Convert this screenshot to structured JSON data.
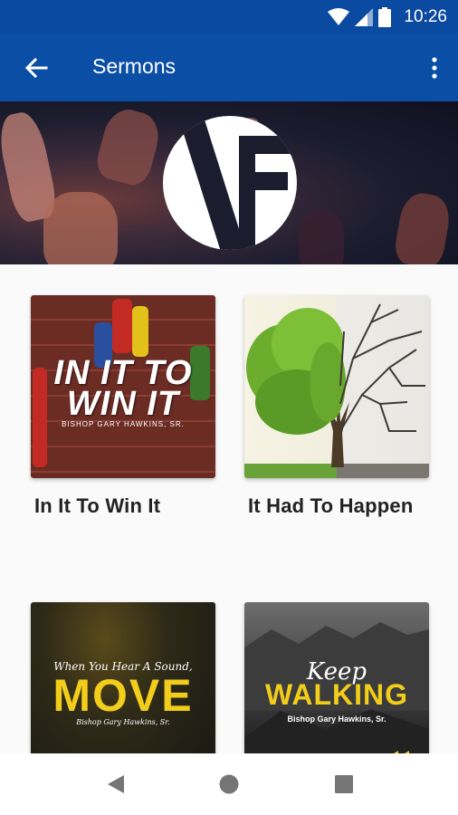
{
  "status_bar": {
    "time": "10:26",
    "icons": [
      "wifi-icon",
      "cell-signal-icon",
      "battery-icon"
    ]
  },
  "app_bar": {
    "title": "Sermons",
    "back_icon": "arrow-left-icon",
    "menu_icon": "more-vert-icon"
  },
  "banner": {
    "logo_icon": "church-logo-icon"
  },
  "sermons": [
    {
      "title": "In It To Win It",
      "thumb_title_line1": "IN IT TO",
      "thumb_title_line2": "WIN IT",
      "thumb_byline": "BISHOP GARY HAWKINS, SR."
    },
    {
      "title": "It Had To Happen"
    },
    {
      "title": "",
      "thumb_script": "When You Hear A Sound,",
      "thumb_title": "MOVE",
      "thumb_byline": "Bishop Gary Hawkins, Sr."
    },
    {
      "title": "",
      "thumb_script": "Keep",
      "thumb_title": "WALKING",
      "thumb_byline": "Bishop Gary Hawkins, Sr."
    }
  ],
  "nav_bar": {
    "back_icon": "nav-back-icon",
    "home_icon": "nav-home-icon",
    "recents_icon": "nav-recents-icon"
  },
  "colors": {
    "app_bar": "#0b4ea6",
    "status_bar": "#0a4aa0",
    "accent_yellow": "#f2cd1a"
  }
}
